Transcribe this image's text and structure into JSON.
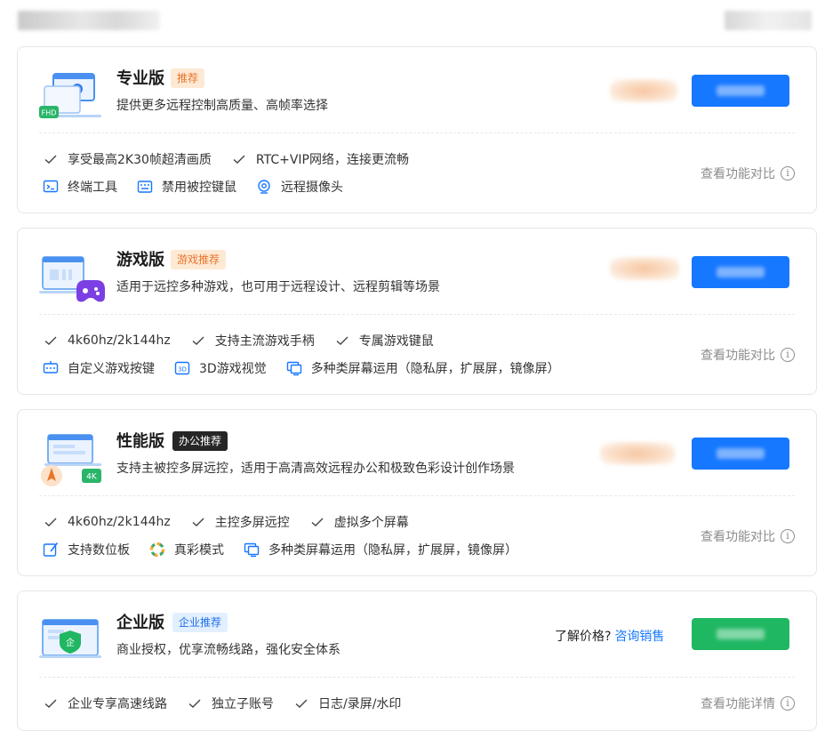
{
  "plans": [
    {
      "title": "专业版",
      "badge": "推荐",
      "desc": "提供更多远程控制高质量、高帧率选择",
      "features_row1": [
        "享受最高2K30帧超清画质",
        "RTC+VIP网络，连接更流畅"
      ],
      "features_row2": [
        {
          "label": "终端工具",
          "icon": "terminal-icon"
        },
        {
          "label": "禁用被控键鼠",
          "icon": "keyboard-disable-icon"
        },
        {
          "label": "远程摄像头",
          "icon": "webcam-icon"
        }
      ],
      "compare": "查看功能对比",
      "illus_tag": "FHD"
    },
    {
      "title": "游戏版",
      "badge": "游戏推荐",
      "desc": "适用于远控多种游戏，也可用于远程设计、远程剪辑等场景",
      "features_row1": [
        "4k60hz/2k144hz",
        "支持主流游戏手柄",
        "专属游戏键鼠"
      ],
      "features_row2": [
        {
          "label": "自定义游戏按键",
          "icon": "custom-keys-icon"
        },
        {
          "label": "3D游戏视觉",
          "icon": "3d-icon",
          "icon_text": "3D"
        },
        {
          "label": "多种类屏幕运用（隐私屏，扩展屏，镜像屏）",
          "icon": "multi-screen-icon"
        }
      ],
      "compare": "查看功能对比"
    },
    {
      "title": "性能版",
      "badge": "办公推荐",
      "desc": "支持主被控多屏远控，适用于高清高效远程办公和极致色彩设计创作场景",
      "features_row1": [
        "4k60hz/2k144hz",
        "主控多屏远控",
        "虚拟多个屏幕"
      ],
      "features_row2": [
        {
          "label": "支持数位板",
          "icon": "tablet-icon"
        },
        {
          "label": "真彩模式",
          "icon": "color-wheel-icon"
        },
        {
          "label": "多种类屏幕运用（隐私屏，扩展屏，镜像屏）",
          "icon": "multi-screen-icon"
        }
      ],
      "compare": "查看功能对比",
      "illus_tag": "4K"
    },
    {
      "title": "企业版",
      "badge": "企业推荐",
      "desc": "商业授权，优享流畅线路，强化安全体系",
      "features_row1": [
        "企业专享高速线路",
        "独立子账号",
        "日志/录屏/水印"
      ],
      "compare": "查看功能详情",
      "price_question": "了解价格?",
      "contact_link": "咨询销售",
      "illus_tag": "企"
    }
  ],
  "icons": {
    "check": "check-icon",
    "info": "info-icon",
    "info_glyph": "i"
  },
  "colors": {
    "accent": "#1677ff",
    "green": "#1fb762",
    "badge_orange_bg": "#fde9d4",
    "badge_orange_fg": "#e8752a",
    "badge_dark": "#262626",
    "badge_blue_bg": "#e2efff"
  }
}
